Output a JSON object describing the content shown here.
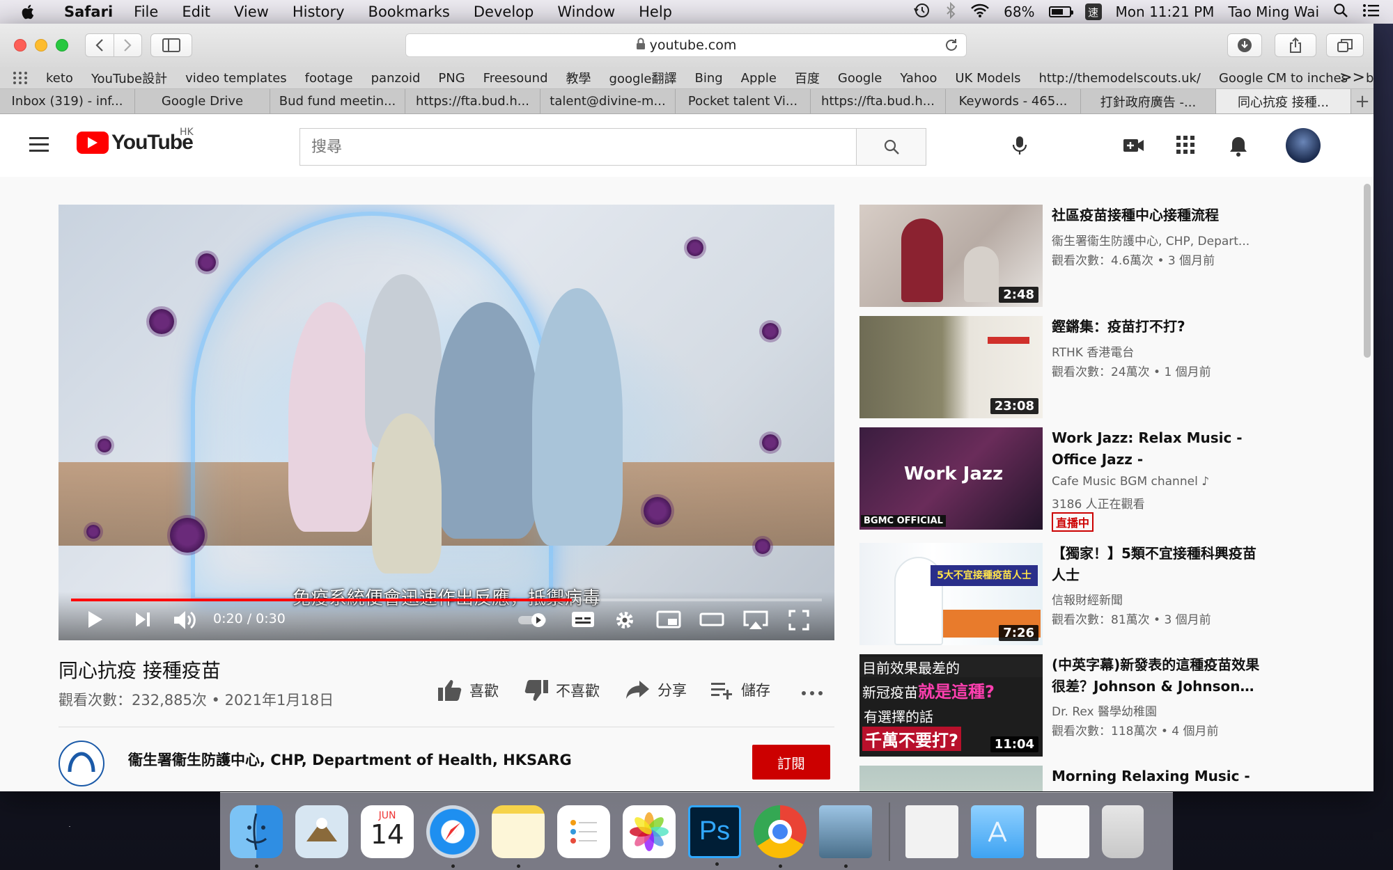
{
  "menubar": {
    "app_name": "Safari",
    "items": [
      "File",
      "Edit",
      "View",
      "History",
      "Bookmarks",
      "Develop",
      "Window",
      "Help"
    ],
    "battery_percent": "68%",
    "battery_level": 0.68,
    "ime": "速",
    "clock": "Mon 11:21 PM",
    "user": "Tao Ming Wai"
  },
  "browser": {
    "url": "youtube.com",
    "bookmarks": [
      "keto",
      "YouTube設計",
      "video templates",
      "footage",
      "panzoid",
      "PNG",
      "Freesound",
      "教學",
      "google翻譯",
      "Bing",
      "Apple",
      "百度",
      "Google",
      "Yahoo",
      "UK Models",
      "http://themodelscouts.uk/",
      "Google CM to inches",
      "book"
    ],
    "bookmarks_more": ">>",
    "tabs": [
      "Inbox (319) - inf...",
      "Google Drive",
      "Bud fund meetin...",
      "https://fta.bud.h...",
      "talent@divine-m...",
      "Pocket talent Vi...",
      "https://fta.bud.h...",
      "Keywords - 465...",
      "打針政府廣告 -...",
      "同心抗疫 接種..."
    ],
    "active_tab": 9
  },
  "youtube": {
    "logo_text": "YouTube",
    "region": "HK",
    "search_placeholder": "搜尋",
    "player": {
      "subtitle": "免疫系統便會迅速作出反應，抵禦病毒",
      "time": "0:20 / 0:30",
      "progress": 0.6667
    },
    "video": {
      "title": "同心抗疫 接種疫苗",
      "meta": "觀看次數：232,885次 • 2021年1月18日",
      "like": "喜歡",
      "dislike": "不喜歡",
      "share": "分享",
      "save": "儲存"
    },
    "channel": {
      "name": "衞生署衞生防護中心, CHP, Department of Health, HKSARG",
      "subscribe": "訂閱"
    },
    "suggestions": [
      {
        "title": "社區疫苗接種中心接種流程",
        "channel": "衞生署衞生防護中心, CHP, Depart...",
        "views": "觀看次數：4.6萬次 • 3 個月前",
        "duration": "2:48"
      },
      {
        "title": "鏗鏘集：疫苗打不打?",
        "channel": "RTHK 香港電台",
        "views": "觀看次數：24萬次 • 1 個月前",
        "duration": "23:08"
      },
      {
        "title": "Work Jazz: Relax Music - Office Jazz - Concentration…",
        "channel": "Cafe Music BGM channel ♪",
        "views": "3186 人正在觀看",
        "live": "直播中",
        "thumb_text": "Work Jazz",
        "thumb_badge": "BGMC OFFICIAL"
      },
      {
        "title": "【獨家！】5類不宜接種科興疫苗人士",
        "channel": "信報財經新聞",
        "views": "觀看次數：81萬次 • 3 個月前",
        "duration": "7:26",
        "thumb_text": "5大不宜接種疫苗人士"
      },
      {
        "title": "(中英字幕)新發表的這種疫苗效果很差？Johnson & Johnson…",
        "channel": "Dr. Rex 醫學幼稚園",
        "views": "觀看次數：118萬次 • 4 個月前",
        "duration": "11:04",
        "thumb_line1": "目前效果最差的",
        "thumb_line2a": "新冠疫苗",
        "thumb_line2b": "就是這種?",
        "thumb_line3": "有選擇的話",
        "thumb_line4": "千萬不要打?"
      },
      {
        "title": "Morning Relaxing Music -",
        "channel": "",
        "views": ""
      }
    ]
  },
  "dock": {
    "calendar_month": "JUN",
    "calendar_day": "14",
    "ps_label": "Ps"
  }
}
